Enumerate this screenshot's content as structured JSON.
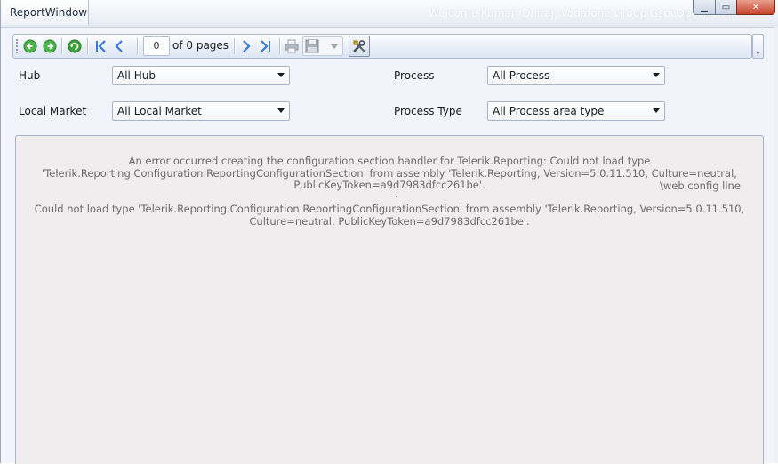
{
  "window": {
    "title": "ReportWindow",
    "welcome": "Welcome Kumar, Dhiraj, Vodafone Group GsocOpcoAdmin"
  },
  "toolbar": {
    "page_number": "0",
    "page_of": "of 0 pages",
    "icons": [
      "back-icon",
      "forward-icon",
      "refresh-icon",
      "first-page-icon",
      "previous-page-icon",
      "next-page-icon",
      "last-page-icon",
      "print-icon",
      "save-icon",
      "export-dropdown-icon",
      "tools-icon"
    ]
  },
  "filters": {
    "hub": {
      "label": "Hub",
      "value": "All Hub"
    },
    "local_market": {
      "label": "Local Market",
      "value": "All Local Market"
    },
    "process": {
      "label": "Process",
      "value": "All Process"
    },
    "process_type": {
      "label": "Process Type",
      "value": "All Process area type"
    }
  },
  "report": {
    "error_message": "An error occurred creating the configuration section handler for Telerik.Reporting: Could not load type 'Telerik.Reporting.Configuration.ReportingConfigurationSection' from assembly 'Telerik.Reporting, Version=5.0.11.510, Culture=neutral, PublicKeyToken=a9d7983dfcc261be'.",
    "web_config_line": "\\web.config line",
    "error_detail": "Could not load type 'Telerik.Reporting.Configuration.ReportingConfigurationSection' from assembly 'Telerik.Reporting, Version=5.0.11.510, Culture=neutral, PublicKeyToken=a9d7983dfcc261be'."
  },
  "colors": {
    "window_bg": "#f1f4fb",
    "report_bg": "#f0edee",
    "nav_blue": "#3b78d8",
    "go_green": "#3aa335",
    "close_red": "#c8432b"
  }
}
